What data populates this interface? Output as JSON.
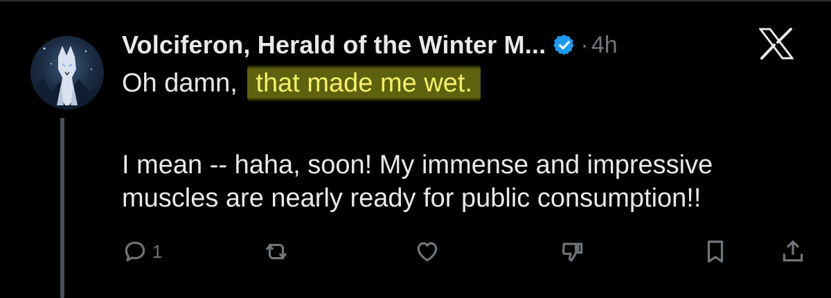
{
  "post": {
    "author_name": "Volciferon, Herald of the Winter M...",
    "separator": "·",
    "time": "4h",
    "line1_prefix": "Oh damn, ",
    "line1_highlight": "that made me wet.",
    "para_line1": "I mean -- haha, soon! My immense and impressive",
    "para_line2": "muscles are nearly ready for public consumption!!"
  },
  "actions": {
    "reply_count": "1",
    "icons": [
      "reply-icon",
      "repost-icon",
      "like-icon",
      "dislike-icon",
      "bookmark-icon",
      "share-icon"
    ]
  },
  "colors": {
    "background": "#000000",
    "text": "#e7e9ea",
    "muted": "#71767b",
    "verified": "#1d9bf0",
    "highlight": "#d8e21c"
  },
  "icons": {
    "avatar": "wolf-avatar",
    "brand": "x-logo-icon"
  }
}
